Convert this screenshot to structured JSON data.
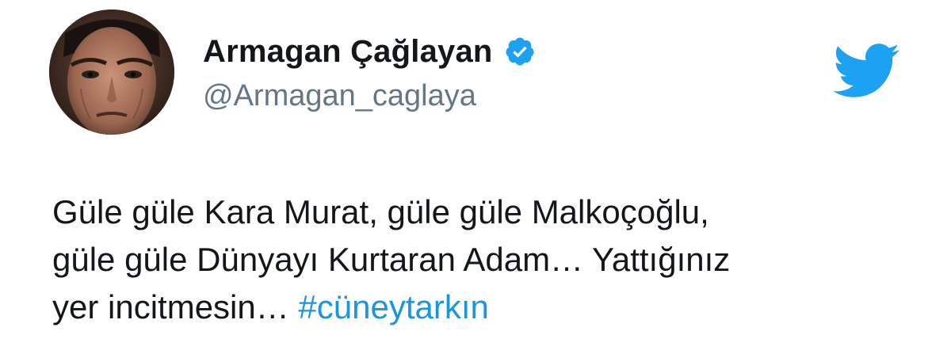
{
  "tweet": {
    "author": {
      "display_name": "Armagan Çağlayan",
      "handle": "@Armagan_caglaya",
      "verified": true,
      "verified_icon": "verified-badge-icon",
      "avatar_icon": "profile-photo"
    },
    "brand_icon": "twitter-bird-icon",
    "text_lines": [
      "Güle güle Kara Murat, güle güle Malkoçoğlu,",
      "güle güle Dünyayı Kurtaran Adam… Yattığınız",
      "yer incitmesin…"
    ],
    "hashtag": "#cüneytarkın"
  },
  "colors": {
    "brand_blue": "#1da1f2",
    "hashtag_blue": "#1b95e0",
    "handle_gray": "#657786",
    "text_dark": "#14171a",
    "background": "#ffffff"
  }
}
